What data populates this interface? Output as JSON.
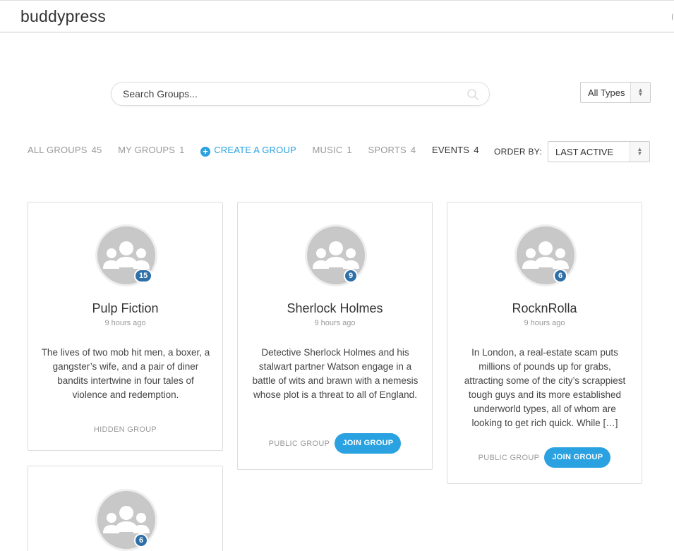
{
  "site": {
    "title": "buddypress"
  },
  "search": {
    "placeholder": "Search Groups..."
  },
  "types_filter": {
    "selected": "All Types"
  },
  "nav": {
    "all_groups": {
      "label": "ALL GROUPS",
      "count": "45"
    },
    "my_groups": {
      "label": "MY GROUPS",
      "count": "1"
    },
    "create": {
      "label": "CREATE A GROUP"
    },
    "music": {
      "label": "MUSIC",
      "count": "1"
    },
    "sports": {
      "label": "SPORTS",
      "count": "4"
    },
    "events": {
      "label": "EVENTS",
      "count": "4"
    }
  },
  "order": {
    "label": "ORDER BY:",
    "selected": "LAST ACTIVE"
  },
  "groups": [
    {
      "name": "Pulp Fiction",
      "time": "9 hours ago",
      "members": "15",
      "description": "The lives of two mob hit men, a boxer, a gangster’s wife, and a pair of diner bandits intertwine in four tales of violence and redemption.",
      "status": "HIDDEN GROUP"
    },
    {
      "name": "Sherlock Holmes",
      "time": "9 hours ago",
      "members": "9",
      "description": "Detective Sherlock Holmes and his stalwart partner Watson engage in a battle of wits and brawn with a nemesis whose plot is a threat to all of England.",
      "status": "PUBLIC GROUP",
      "join_label": "JOIN GROUP"
    },
    {
      "name": "RocknRolla",
      "time": "9 hours ago",
      "members": "6",
      "description": "In London, a real-estate scam puts millions of pounds up for grabs, attracting some of the city’s scrappiest tough guys and its more established underworld types, all of whom are looking to get rich quick. While […]",
      "status": "PUBLIC GROUP",
      "join_label": "JOIN GROUP"
    },
    {
      "members": "6"
    }
  ]
}
